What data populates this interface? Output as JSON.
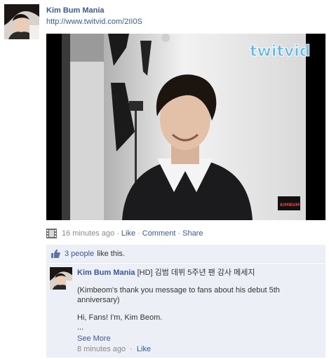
{
  "post": {
    "author": "Kim Bum Mania",
    "link": "http://www.twitvid.com/2II0S",
    "video": {
      "watermark": "twitvid",
      "corner_logo": "KIMBUM"
    },
    "time": "16 minutes ago",
    "actions": {
      "like": "Like",
      "comment": "Comment",
      "share": "Share"
    },
    "likes": {
      "people": "3 people",
      "text": "like this."
    }
  },
  "comment": {
    "author": "Kim Bum Mania",
    "text_inline": "[HD] 김범 데뷔 5주년 팬 감사 메세지",
    "para1": "(Kimbeom's thank you message to fans about his debut 5th anniversary)",
    "para2": "Hi, Fans! I'm, Kim Beom.",
    "ellipsis": "...",
    "see_more": "See More",
    "time": "8 minutes ago",
    "like": "Like"
  },
  "colors": {
    "link": "#3b5998",
    "panel": "#eceff5",
    "muted": "#8a8a8a"
  },
  "icons": [
    "profile-photo",
    "film-strip-icon",
    "thumbs-up-icon"
  ]
}
